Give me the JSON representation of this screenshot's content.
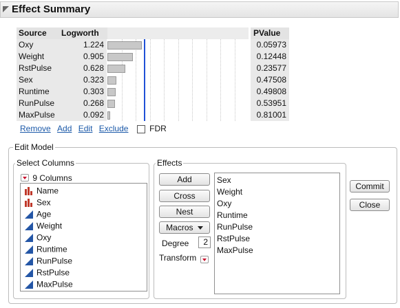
{
  "header": {
    "title": "Effect Summary"
  },
  "summary": {
    "columns": {
      "source": "Source",
      "logworth": "Logworth",
      "pvalue": "PValue"
    },
    "rows": [
      {
        "source": "Oxy",
        "logworth": "1.224",
        "pvalue": "0.05973",
        "bar_value": 1.224
      },
      {
        "source": "Weight",
        "logworth": "0.905",
        "pvalue": "0.12448",
        "bar_value": 0.905
      },
      {
        "source": "RstPulse",
        "logworth": "0.628",
        "pvalue": "0.23577",
        "bar_value": 0.628
      },
      {
        "source": "Sex",
        "logworth": "0.323",
        "pvalue": "0.47508",
        "bar_value": 0.323
      },
      {
        "source": "Runtime",
        "logworth": "0.303",
        "pvalue": "0.49808",
        "bar_value": 0.303
      },
      {
        "source": "RunPulse",
        "logworth": "0.268",
        "pvalue": "0.53951",
        "bar_value": 0.268
      },
      {
        "source": "MaxPulse",
        "logworth": "0.092",
        "pvalue": "0.81001",
        "bar_value": 0.092
      }
    ],
    "bar_scale_max": 5,
    "reference_line_value": 1.301,
    "reference_line_color": "#1f50d6",
    "links": {
      "remove": "Remove",
      "add": "Add",
      "edit": "Edit",
      "exclude": "Exclude"
    },
    "fdr_label": "FDR",
    "fdr_checked": false
  },
  "edit_model": {
    "title": "Edit Model",
    "select_columns": {
      "title": "Select Columns",
      "count_label": "9 Columns",
      "columns": [
        {
          "name": "Name",
          "icon": "nominal-bar-icon"
        },
        {
          "name": "Sex",
          "icon": "nominal-bar-icon"
        },
        {
          "name": "Age",
          "icon": "continuous-triangle-icon"
        },
        {
          "name": "Weight",
          "icon": "continuous-triangle-icon"
        },
        {
          "name": "Oxy",
          "icon": "continuous-triangle-icon"
        },
        {
          "name": "Runtime",
          "icon": "continuous-triangle-icon"
        },
        {
          "name": "RunPulse",
          "icon": "continuous-triangle-icon"
        },
        {
          "name": "RstPulse",
          "icon": "continuous-triangle-icon"
        },
        {
          "name": "MaxPulse",
          "icon": "continuous-triangle-icon"
        }
      ]
    },
    "effects": {
      "title": "Effects",
      "buttons": {
        "add": "Add",
        "cross": "Cross",
        "nest": "Nest",
        "macros": "Macros"
      },
      "degree_label": "Degree",
      "degree_value": "2",
      "transform_label": "Transform",
      "list": [
        "Sex",
        "Weight",
        "Oxy",
        "Runtime",
        "RunPulse",
        "RstPulse",
        "MaxPulse"
      ]
    },
    "commit_label": "Commit",
    "close_label": "Close"
  },
  "colors": {
    "nominal_icon": "#c0392b",
    "continuous_icon": "#2456a6",
    "link": "#1a58a8"
  }
}
